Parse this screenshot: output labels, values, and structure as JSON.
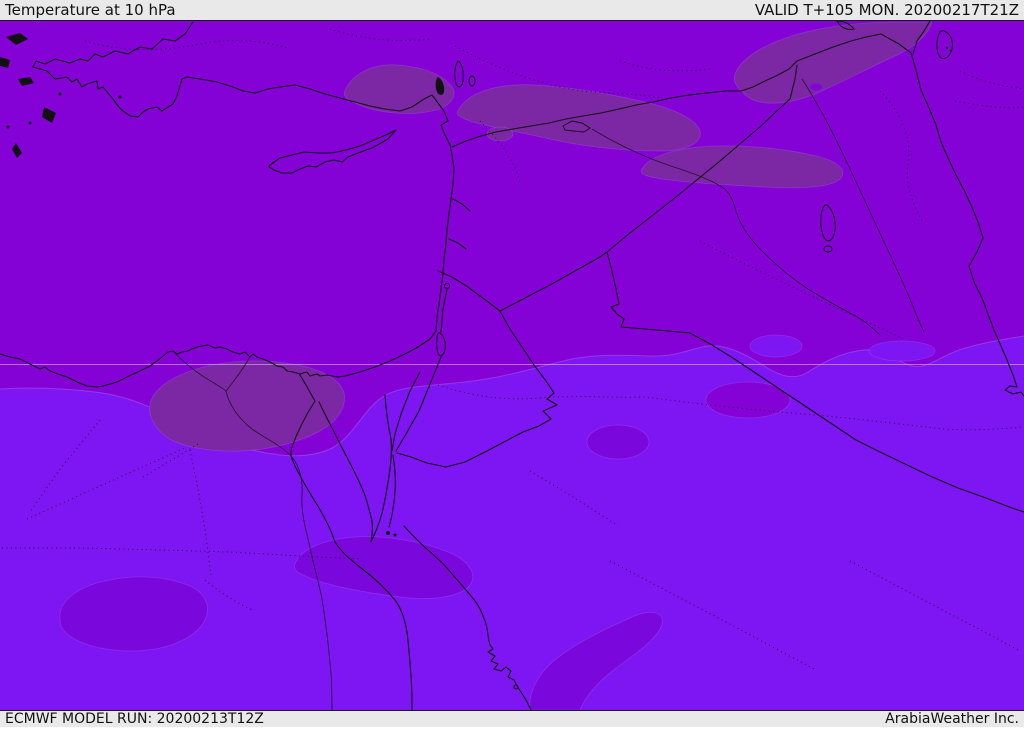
{
  "header": {
    "title": "Temperature at 10 hPa",
    "valid_label": "VALID T+105 MON. 20200217T21Z"
  },
  "footer": {
    "model_run": "ECMWF MODEL RUN: 20200213T12Z",
    "credit": "ArabiaWeather Inc."
  },
  "map": {
    "colors": {
      "upper_zone": "#8502d6",
      "lower_zone": "#7e16f3",
      "muted_blob": "#7c28a5",
      "lower_blob": "#7a08dd",
      "contour_edge": "#a55ce8",
      "coastline": "#111111",
      "graticule": "#d9b8f0",
      "bar_bg": "#e9e9e9",
      "text": "#111111"
    }
  }
}
